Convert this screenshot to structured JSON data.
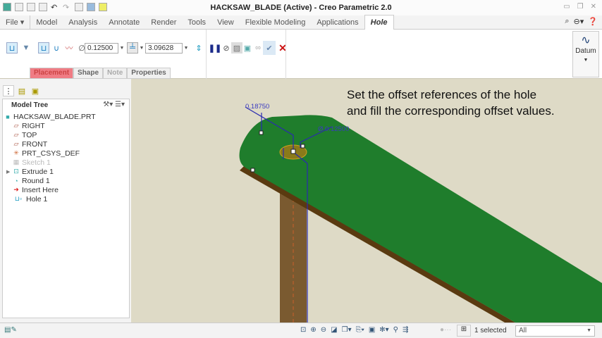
{
  "window": {
    "title": "HACKSAW_BLADE (Active) - Creo Parametric 2.0"
  },
  "menu": {
    "tabs": [
      "File",
      "Model",
      "Analysis",
      "Annotate",
      "Render",
      "Tools",
      "View",
      "Flexible Modeling",
      "Applications",
      "Hole"
    ]
  },
  "ribbon": {
    "diameter": "0.12500",
    "depth": "3.09628",
    "datum_label": "Datum"
  },
  "subtabs": [
    "Placement",
    "Shape",
    "Note",
    "Properties"
  ],
  "tree": {
    "header": "Model Tree",
    "items": [
      {
        "label": "HACKSAW_BLADE.PRT",
        "icon": "part-icon"
      },
      {
        "label": "RIGHT",
        "icon": "datum-plane-icon"
      },
      {
        "label": "TOP",
        "icon": "datum-plane-icon"
      },
      {
        "label": "FRONT",
        "icon": "datum-plane-icon"
      },
      {
        "label": "PRT_CSYS_DEF",
        "icon": "csys-icon"
      },
      {
        "label": "Sketch 1",
        "icon": "sketch-icon"
      },
      {
        "label": "Extrude 1",
        "icon": "extrude-icon"
      },
      {
        "label": "Round 1",
        "icon": "round-icon"
      },
      {
        "label": "Insert Here",
        "icon": "insert-arrow-icon"
      },
      {
        "label": "Hole 1",
        "icon": "hole-icon"
      }
    ]
  },
  "viewport": {
    "instruction_line1": "Set the offset references of the hole",
    "instruction_line2": "and fill the corresponding offset values.",
    "offset_dim": "0.18750",
    "diameter_dim": "Ø 0.12500"
  },
  "status": {
    "selected": "1 selected",
    "filter": "All"
  },
  "colors": {
    "blade": "#1f7d2c",
    "blade_edge": "#5a3a10",
    "dimension": "#2a2ab0",
    "placement_tab": "#f07c84"
  }
}
